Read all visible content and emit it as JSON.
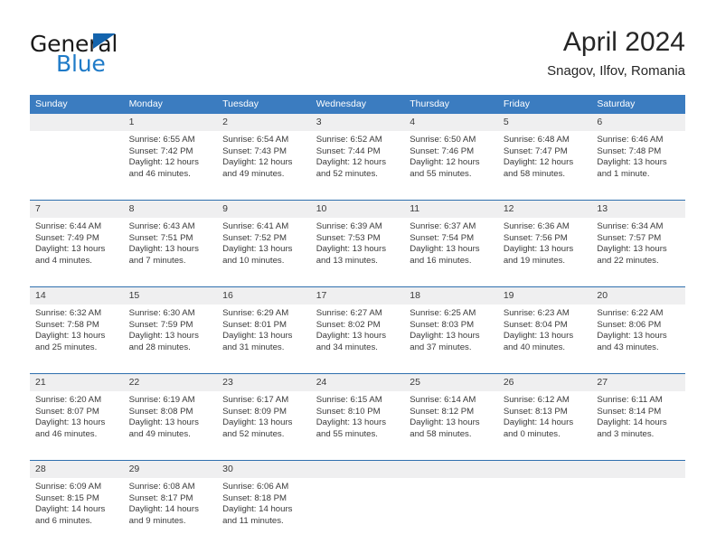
{
  "brand": {
    "name_top": "General",
    "name_bottom": "Blue"
  },
  "header": {
    "title": "April 2024",
    "subtitle": "Snagov, Ilfov, Romania"
  },
  "colors": {
    "header_blue": "#3b7cc0",
    "row_divider_blue": "#2f6fae",
    "daynum_band": "#efeff0",
    "brand_blue": "#1f7bc8",
    "text": "#3a3a3a"
  },
  "labels": {
    "sunrise_prefix": "Sunrise:",
    "sunset_prefix": "Sunset:",
    "daylight_prefix": "Daylight:"
  },
  "weekday_headers": [
    "Sunday",
    "Monday",
    "Tuesday",
    "Wednesday",
    "Thursday",
    "Friday",
    "Saturday"
  ],
  "weeks": [
    [
      {
        "day": "",
        "sunrise": "",
        "sunset": "",
        "daylight_a": "",
        "daylight_b": ""
      },
      {
        "day": "1",
        "sunrise": "Sunrise: 6:55 AM",
        "sunset": "Sunset: 7:42 PM",
        "daylight_a": "Daylight: 12 hours",
        "daylight_b": "and 46 minutes."
      },
      {
        "day": "2",
        "sunrise": "Sunrise: 6:54 AM",
        "sunset": "Sunset: 7:43 PM",
        "daylight_a": "Daylight: 12 hours",
        "daylight_b": "and 49 minutes."
      },
      {
        "day": "3",
        "sunrise": "Sunrise: 6:52 AM",
        "sunset": "Sunset: 7:44 PM",
        "daylight_a": "Daylight: 12 hours",
        "daylight_b": "and 52 minutes."
      },
      {
        "day": "4",
        "sunrise": "Sunrise: 6:50 AM",
        "sunset": "Sunset: 7:46 PM",
        "daylight_a": "Daylight: 12 hours",
        "daylight_b": "and 55 minutes."
      },
      {
        "day": "5",
        "sunrise": "Sunrise: 6:48 AM",
        "sunset": "Sunset: 7:47 PM",
        "daylight_a": "Daylight: 12 hours",
        "daylight_b": "and 58 minutes."
      },
      {
        "day": "6",
        "sunrise": "Sunrise: 6:46 AM",
        "sunset": "Sunset: 7:48 PM",
        "daylight_a": "Daylight: 13 hours",
        "daylight_b": "and 1 minute."
      }
    ],
    [
      {
        "day": "7",
        "sunrise": "Sunrise: 6:44 AM",
        "sunset": "Sunset: 7:49 PM",
        "daylight_a": "Daylight: 13 hours",
        "daylight_b": "and 4 minutes."
      },
      {
        "day": "8",
        "sunrise": "Sunrise: 6:43 AM",
        "sunset": "Sunset: 7:51 PM",
        "daylight_a": "Daylight: 13 hours",
        "daylight_b": "and 7 minutes."
      },
      {
        "day": "9",
        "sunrise": "Sunrise: 6:41 AM",
        "sunset": "Sunset: 7:52 PM",
        "daylight_a": "Daylight: 13 hours",
        "daylight_b": "and 10 minutes."
      },
      {
        "day": "10",
        "sunrise": "Sunrise: 6:39 AM",
        "sunset": "Sunset: 7:53 PM",
        "daylight_a": "Daylight: 13 hours",
        "daylight_b": "and 13 minutes."
      },
      {
        "day": "11",
        "sunrise": "Sunrise: 6:37 AM",
        "sunset": "Sunset: 7:54 PM",
        "daylight_a": "Daylight: 13 hours",
        "daylight_b": "and 16 minutes."
      },
      {
        "day": "12",
        "sunrise": "Sunrise: 6:36 AM",
        "sunset": "Sunset: 7:56 PM",
        "daylight_a": "Daylight: 13 hours",
        "daylight_b": "and 19 minutes."
      },
      {
        "day": "13",
        "sunrise": "Sunrise: 6:34 AM",
        "sunset": "Sunset: 7:57 PM",
        "daylight_a": "Daylight: 13 hours",
        "daylight_b": "and 22 minutes."
      }
    ],
    [
      {
        "day": "14",
        "sunrise": "Sunrise: 6:32 AM",
        "sunset": "Sunset: 7:58 PM",
        "daylight_a": "Daylight: 13 hours",
        "daylight_b": "and 25 minutes."
      },
      {
        "day": "15",
        "sunrise": "Sunrise: 6:30 AM",
        "sunset": "Sunset: 7:59 PM",
        "daylight_a": "Daylight: 13 hours",
        "daylight_b": "and 28 minutes."
      },
      {
        "day": "16",
        "sunrise": "Sunrise: 6:29 AM",
        "sunset": "Sunset: 8:01 PM",
        "daylight_a": "Daylight: 13 hours",
        "daylight_b": "and 31 minutes."
      },
      {
        "day": "17",
        "sunrise": "Sunrise: 6:27 AM",
        "sunset": "Sunset: 8:02 PM",
        "daylight_a": "Daylight: 13 hours",
        "daylight_b": "and 34 minutes."
      },
      {
        "day": "18",
        "sunrise": "Sunrise: 6:25 AM",
        "sunset": "Sunset: 8:03 PM",
        "daylight_a": "Daylight: 13 hours",
        "daylight_b": "and 37 minutes."
      },
      {
        "day": "19",
        "sunrise": "Sunrise: 6:23 AM",
        "sunset": "Sunset: 8:04 PM",
        "daylight_a": "Daylight: 13 hours",
        "daylight_b": "and 40 minutes."
      },
      {
        "day": "20",
        "sunrise": "Sunrise: 6:22 AM",
        "sunset": "Sunset: 8:06 PM",
        "daylight_a": "Daylight: 13 hours",
        "daylight_b": "and 43 minutes."
      }
    ],
    [
      {
        "day": "21",
        "sunrise": "Sunrise: 6:20 AM",
        "sunset": "Sunset: 8:07 PM",
        "daylight_a": "Daylight: 13 hours",
        "daylight_b": "and 46 minutes."
      },
      {
        "day": "22",
        "sunrise": "Sunrise: 6:19 AM",
        "sunset": "Sunset: 8:08 PM",
        "daylight_a": "Daylight: 13 hours",
        "daylight_b": "and 49 minutes."
      },
      {
        "day": "23",
        "sunrise": "Sunrise: 6:17 AM",
        "sunset": "Sunset: 8:09 PM",
        "daylight_a": "Daylight: 13 hours",
        "daylight_b": "and 52 minutes."
      },
      {
        "day": "24",
        "sunrise": "Sunrise: 6:15 AM",
        "sunset": "Sunset: 8:10 PM",
        "daylight_a": "Daylight: 13 hours",
        "daylight_b": "and 55 minutes."
      },
      {
        "day": "25",
        "sunrise": "Sunrise: 6:14 AM",
        "sunset": "Sunset: 8:12 PM",
        "daylight_a": "Daylight: 13 hours",
        "daylight_b": "and 58 minutes."
      },
      {
        "day": "26",
        "sunrise": "Sunrise: 6:12 AM",
        "sunset": "Sunset: 8:13 PM",
        "daylight_a": "Daylight: 14 hours",
        "daylight_b": "and 0 minutes."
      },
      {
        "day": "27",
        "sunrise": "Sunrise: 6:11 AM",
        "sunset": "Sunset: 8:14 PM",
        "daylight_a": "Daylight: 14 hours",
        "daylight_b": "and 3 minutes."
      }
    ],
    [
      {
        "day": "28",
        "sunrise": "Sunrise: 6:09 AM",
        "sunset": "Sunset: 8:15 PM",
        "daylight_a": "Daylight: 14 hours",
        "daylight_b": "and 6 minutes."
      },
      {
        "day": "29",
        "sunrise": "Sunrise: 6:08 AM",
        "sunset": "Sunset: 8:17 PM",
        "daylight_a": "Daylight: 14 hours",
        "daylight_b": "and 9 minutes."
      },
      {
        "day": "30",
        "sunrise": "Sunrise: 6:06 AM",
        "sunset": "Sunset: 8:18 PM",
        "daylight_a": "Daylight: 14 hours",
        "daylight_b": "and 11 minutes."
      },
      {
        "day": "",
        "sunrise": "",
        "sunset": "",
        "daylight_a": "",
        "daylight_b": ""
      },
      {
        "day": "",
        "sunrise": "",
        "sunset": "",
        "daylight_a": "",
        "daylight_b": ""
      },
      {
        "day": "",
        "sunrise": "",
        "sunset": "",
        "daylight_a": "",
        "daylight_b": ""
      },
      {
        "day": "",
        "sunrise": "",
        "sunset": "",
        "daylight_a": "",
        "daylight_b": ""
      }
    ]
  ]
}
